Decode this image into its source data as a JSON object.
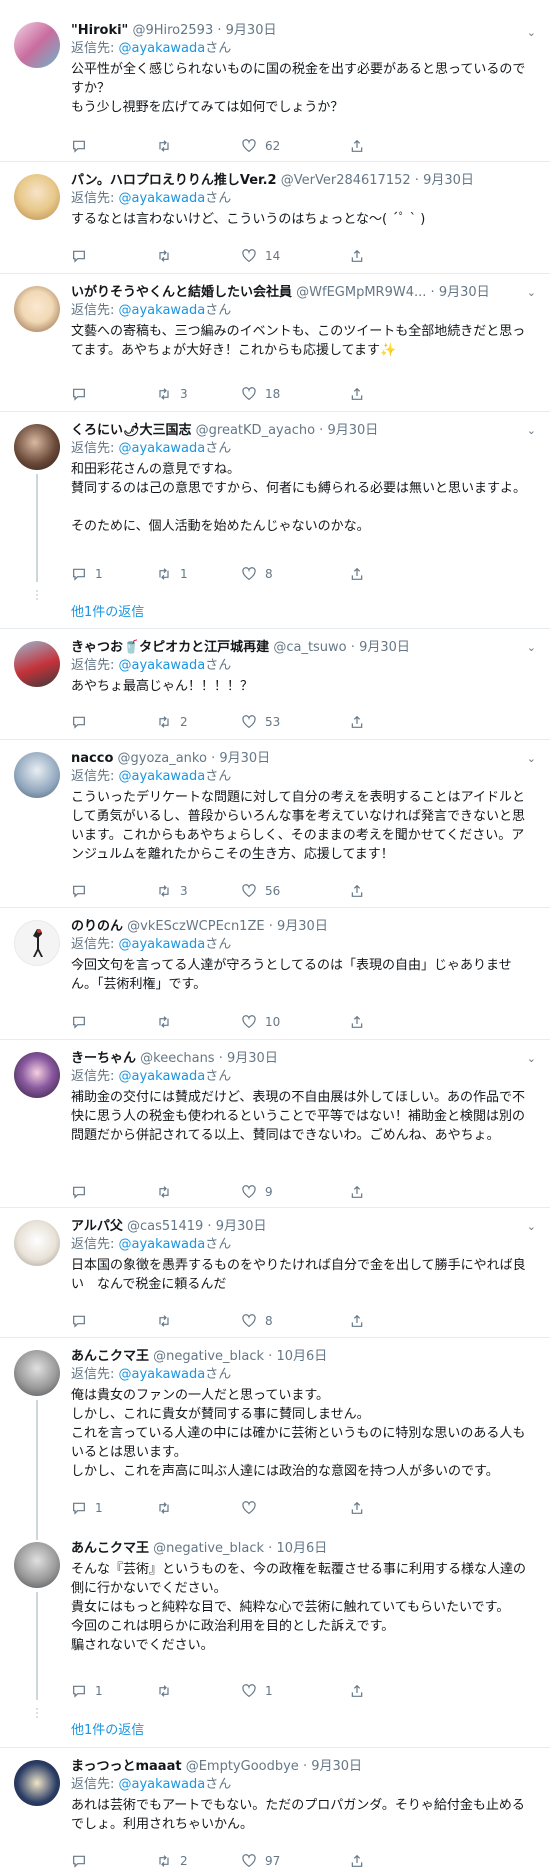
{
  "reply_prefix": "返信先: ",
  "reply_suffix": "さん",
  "tweets": [
    {
      "name": "\"Hiroki\"",
      "handle": "@9Hiro2593",
      "date": "9月30日",
      "reply": "@ayakawada",
      "text": "公平性が全く感じられないものに国の税金を出す必要があると思っているのですか？\nもう少し視野を広げてみては如何でしょうか？",
      "replies": "",
      "retweets": "",
      "likes": "62",
      "avatar_color": "#c96d9e"
    },
    {
      "name": "パン。ハロプロえりりん推しVer.2",
      "handle": "@VerVer284617152",
      "date": "9月30日",
      "reply": "@ayakawada",
      "text": "するなとは言わないけど、こういうのはちょっとな〜( ´ﾟ ` )",
      "replies": "",
      "retweets": "",
      "likes": "14",
      "avatar_color": "#e8c98a"
    },
    {
      "name": "いがりそうやくんと結婚したい会社員",
      "handle": "@WfEGMpMR9W4...",
      "date": "9月30日",
      "reply": "@ayakawada",
      "text": "文藝への寄稿も、三つ編みのイベントも、このツイートも全部地続きだと思ってます。あやちょが大好き！これからも応援してます✨",
      "replies": "",
      "retweets": "3",
      "likes": "18",
      "avatar_color": "#f1d9b5"
    },
    {
      "name": "くろにい🌶大三国志",
      "handle": "@greatKD_ayacho",
      "date": "9月30日",
      "reply": "@ayakawada",
      "text": "和田彩花さんの意見ですね。\n賛同するのは己の意思ですから、何者にも縛られる必要は無いと思いますよ。\n\nそのために、個人活動を始めたんじゃないのかな。",
      "replies": "1",
      "retweets": "1",
      "likes": "8",
      "avatar_color": "#6b4a3a",
      "more": "他1件の返信"
    },
    {
      "name": "きゃつお🥤タピオカと江戸城再建",
      "handle": "@ca_tsuwo",
      "date": "9月30日",
      "reply": "@ayakawada",
      "text": "あやちょ最高じゃん！！！！？",
      "replies": "",
      "retweets": "2",
      "likes": "53",
      "avatar_color": "#c4323a"
    },
    {
      "name": "nacco",
      "handle": "@gyoza_anko",
      "date": "9月30日",
      "reply": "@ayakawada",
      "text": "こういったデリケートな問題に対して自分の考えを表明することはアイドルとして勇気がいるし、普段からいろんな事を考えていなければ発言できないと思います。これからもあやちょらしく、そのままの考えを聞かせてください。アンジュルムを離れたからこその生き方、応援してます！",
      "replies": "",
      "retweets": "3",
      "likes": "56",
      "avatar_color": "#8fa6bd"
    },
    {
      "name": "のりのん",
      "handle": "@vkESczWCPEcn1ZE",
      "date": "9月30日",
      "reply": "@ayakawada",
      "text": "今回文句を言ってる人達が守ろうとしてるのは「表現の自由」じゃありません。「芸術利権」です。",
      "replies": "",
      "retweets": "",
      "likes": "10",
      "avatar_color": "#eeeeee"
    },
    {
      "name": "きーちゃん",
      "handle": "@keechans",
      "date": "9月30日",
      "reply": "@ayakawada",
      "text": "補助金の交付には賛成だけど、表現の不自由展は外してほしい。あの作品で不快に思う人の税金も使われるということで平等ではない！補助金と検閲は別の問題だから併記されてる以上、賛同はできないわ。ごめんね、あやちょ。",
      "replies": "",
      "retweets": "",
      "likes": "9",
      "avatar_color": "#4a2a55"
    },
    {
      "name": "アルパ父",
      "handle": "@cas51419",
      "date": "9月30日",
      "reply": "@ayakawada",
      "text": "日本国の象徴を愚弄するものをやりたければ自分で金を出して勝手にやれば良い　なんで税金に頼るんだ",
      "replies": "",
      "retweets": "",
      "likes": "8",
      "avatar_color": "#e8e2d8"
    },
    {
      "name": "あんこクマ王",
      "handle": "@negative_black",
      "date": "10月6日",
      "reply": "@ayakawada",
      "text": "俺は貴女のファンの一人だと思っています。\nしかし、これに貴女が賛同する事に賛同しません。\nこれを言っている人達の中には確かに芸術というものに特別な思いのある人もいるとは思います。\nしかし、これを声高に叫ぶ人達には政治的な意図を持つ人が多いのです。",
      "replies": "1",
      "retweets": "",
      "likes": "",
      "avatar_color": "#9a9a9a"
    },
    {
      "name": "あんこクマ王",
      "handle": "@negative_black",
      "date": "10月6日",
      "reply": "",
      "text": "そんな『芸術』というものを、今の政権を転覆させる事に利用する様な人達の側に行かないでください。\n貴女にはもっと純粋な目で、純粋な心で芸術に触れていてもらいたいです。\n今回のこれは明らかに政治利用を目的とした訴えです。\n騙されないでください。",
      "replies": "1",
      "retweets": "",
      "likes": "1",
      "avatar_color": "#9a9a9a",
      "more": "他1件の返信"
    },
    {
      "name": "まっつっとmaaat",
      "handle": "@EmptyGoodbye",
      "date": "9月30日",
      "reply": "@ayakawada",
      "text": "あれは芸術でもアートでもない。ただのプロパガンダ。そりゃ給付金も止めるでしょ。利用されちゃいかん。",
      "replies": "",
      "retweets": "2",
      "likes": "97",
      "avatar_color": "#2c3e66"
    }
  ]
}
